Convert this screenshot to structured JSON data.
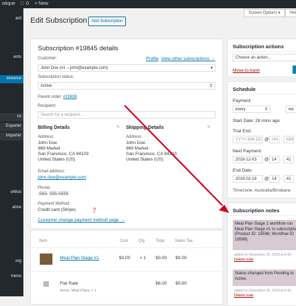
{
  "admin_bar": {
    "site_name": "otique",
    "comments_count": "0",
    "new_label": "+ New"
  },
  "sidebar": {
    "items": [
      {
        "label": "ard"
      },
      {
        "label": "ents"
      },
      {
        "label": "mmerce"
      },
      {
        "label": "ns"
      },
      {
        "label": "Exporter"
      },
      {
        "label": "Importer"
      },
      {
        "label": "eWoo"
      },
      {
        "label": "ance"
      },
      {
        "label": "org"
      },
      {
        "label": "menu"
      }
    ]
  },
  "screen_options": "Screen Options ▾",
  "help_label": "Help ▾",
  "page": {
    "title": "Edit Subscription",
    "add_button": "Add Subscription"
  },
  "subscription": {
    "heading": "Subscription #19845 details",
    "customer_label": "Customer:",
    "profile_link": "Profile",
    "view_other_link": "View other subscriptions →",
    "customer_value": "John Doe (#1 – john@example.com)",
    "status_label": "Subscription status:",
    "status_value": "Active",
    "parent_order_label": "Parent order:",
    "parent_order_link": "#19838",
    "recipient_label": "Recipient:",
    "recipient_placeholder": "Search for a recipient…",
    "billing": {
      "heading": "Billing Details",
      "address_label": "Address:",
      "address_lines": [
        "John Doe",
        "969 Market",
        "San Francisco, CA 94103",
        "United States (US)"
      ],
      "email_label": "Email address:",
      "email": "john.doe@example.com",
      "phone_label": "Phone:",
      "phone": "-555- 555-5555",
      "payment_label": "Payment Method:",
      "payment_value": "Credit card (Stripe)",
      "change_link": "Customer change payment method page →"
    },
    "shipping": {
      "heading": "Shipping Details",
      "address_label": "Address:",
      "address_lines": [
        "John Doe",
        "969 Market",
        "San Francisco, CA 94103",
        "United States (US)"
      ]
    }
  },
  "items_table": {
    "headers": {
      "item": "Item",
      "cost": "Cost",
      "qty": "Qty",
      "total": "Total",
      "tax": "Sales Tax"
    },
    "rows": [
      {
        "name": "Meal Plan Stage #1",
        "cost": "$0.00",
        "qty": "× 1",
        "total": "$0.00",
        "tax": "$0.00"
      }
    ],
    "shipping": {
      "name": "Flat Rate",
      "items": "Items: Meal Plans × 1",
      "total": "$6.00",
      "tax": "$0.60"
    }
  },
  "actions": {
    "heading": "Subscription actions",
    "select_value": "Choose an action...",
    "trash": "Move to trash"
  },
  "schedule": {
    "heading": "Schedule",
    "payment_label": "Payment:",
    "interval": "every",
    "period": "we",
    "start_label": "Start Date:",
    "start_value": "28 mins ago",
    "trial_label": "Trial End:",
    "trial_date_placeholder": "YYYY-MM-DD",
    "trial_hh": "HH",
    "trial_mm": "MM",
    "next_label": "Next Payment:",
    "next_date": "2018-12-03",
    "next_hh": "14",
    "next_mm": "41",
    "end_label": "End Date:",
    "end_date": "2019-02-18",
    "end_hh": "14",
    "end_mm": "41",
    "timezone": "Timezone: Australia/Brisbane"
  },
  "notes": {
    "heading": "Subscription notes",
    "items": [
      {
        "text": "Meal Plan Stage 1 workflow run Meal Plan Stage #1 to subscriptio (Product ID: 19598; Workflow ID 19596)",
        "meta": "added on November 20, 2018 at 8:43",
        "delete": "Delete note"
      },
      {
        "text": "Status changed from Pending to Active.",
        "meta": "added on November 20, 2018 at 8:43",
        "delete": "Delete note"
      }
    ]
  },
  "colors": {
    "arrow": "#d0021b",
    "accent": "#0073aa",
    "note_bg": "#d7cad2"
  }
}
